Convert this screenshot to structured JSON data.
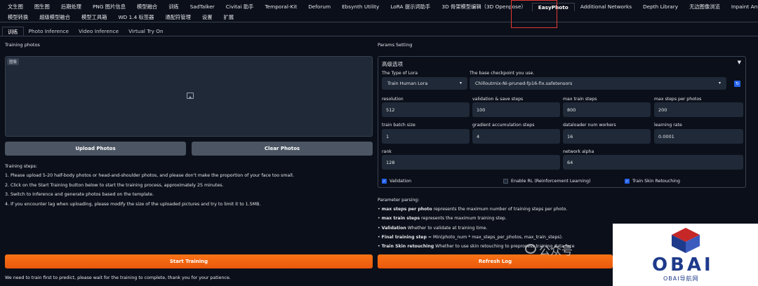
{
  "top_tabs_row1": [
    "文生图",
    "图生图",
    "后期处理",
    "PNG 图片信息",
    "模型融合",
    "训练",
    "SadTalker",
    "Civitai 助手",
    "Temporal-Kit",
    "Deforum",
    "Ebsynth Utility",
    "LoRA 提示词助手",
    "3D 骨架模型编辑（3D Openpose）",
    "EasyPhoto",
    "Additional Networks",
    "Depth Library",
    "无边图像浏览",
    "Inpaint Anything"
  ],
  "top_tabs_row2": [
    "模型转换",
    "超级模型融合",
    "模型工具箱",
    "WD 1.4 标签器",
    "通配符管理",
    "设置",
    "扩展"
  ],
  "sub_tabs": [
    "训练",
    "Photo Inference",
    "Video Inference",
    "Virtual Try On"
  ],
  "training_photos_label": "Training photos",
  "dropzone_tag": "图像",
  "upload_button": "Upload Photos",
  "clear_button": "Clear Photos",
  "steps_title": "Training steps:",
  "steps": [
    "1. Please upload 5-20 half-body photos or head-and-shoulder photos, and please don't make the proportion of your face too small.",
    "2. Click on the Start Training button below to start the training process, approximately 25 minutes.",
    "3. Switch to Inference and generate photos based on the template.",
    "4. If you encounter lag when uploading, please modify the size of the uploaded pictures and try to limit it to 1.5MB."
  ],
  "params_setting_label": "Params Setting",
  "advanced_label": "高级选项",
  "lora_type_label": "The Type of Lora",
  "lora_type_value": "Train Human Lora",
  "checkpoint_label": "The base checkpoint you use.",
  "checkpoint_value": "Chilloutmix-Ni-pruned-fp16-fix.safetensors",
  "params": {
    "resolution": {
      "label": "resolution",
      "value": "512"
    },
    "validation_save_steps": {
      "label": "validation & save steps",
      "value": "100"
    },
    "max_train_steps": {
      "label": "max train steps",
      "value": "800"
    },
    "max_steps_per_photos": {
      "label": "max steps per photos",
      "value": "200"
    },
    "train_batch_size": {
      "label": "train batch size",
      "value": "1"
    },
    "gradient_accumulation_steps": {
      "label": "gradient accumulation steps",
      "value": "4"
    },
    "dataloader_num_workers": {
      "label": "dataloader num workers",
      "value": "16"
    },
    "learning_rate": {
      "label": "learning rate",
      "value": "0.0001"
    },
    "rank": {
      "label": "rank",
      "value": "128"
    },
    "network_alpha": {
      "label": "network alpha",
      "value": "64"
    }
  },
  "checkboxes": {
    "validation": {
      "label": "Validation",
      "checked": true
    },
    "enable_rl": {
      "label": "Enable RL (Reinforcement Learning)",
      "checked": false
    },
    "skin_retouching": {
      "label": "Train Skin Retouching",
      "checked": true
    }
  },
  "parsing_title": "Parameter parsing:",
  "parsing": [
    {
      "bold": "max steps per photo",
      "text": " represents the maximum number of training steps per photo."
    },
    {
      "bold": "max train steps",
      "text": " represents the maximum training step."
    },
    {
      "bold": "Validation",
      "text": " Whether to validate at training time."
    },
    {
      "bold": "Final training step",
      "text": " = Min(photo_num * max_steps_per_photos, max_train_steps)."
    },
    {
      "bold": "Train Skin retouching",
      "text": " Whether to use skin retouching to preprocess training data face"
    }
  ],
  "start_training_button": "Start Training",
  "refresh_log_button": "Refresh Log",
  "footer_note": "We need to train first to predict, please wait for the training to complete, thank you for your patience.",
  "watermark_text": "公众号",
  "logo_text": "OBAI",
  "logo_subtext": "OBAI导航网",
  "colors": {
    "background": "#0b0f19",
    "accent_orange": "#f97316",
    "highlight_red": "#e53935",
    "logo_blue": "#1e3a8a",
    "logo_red": "#c62828"
  }
}
